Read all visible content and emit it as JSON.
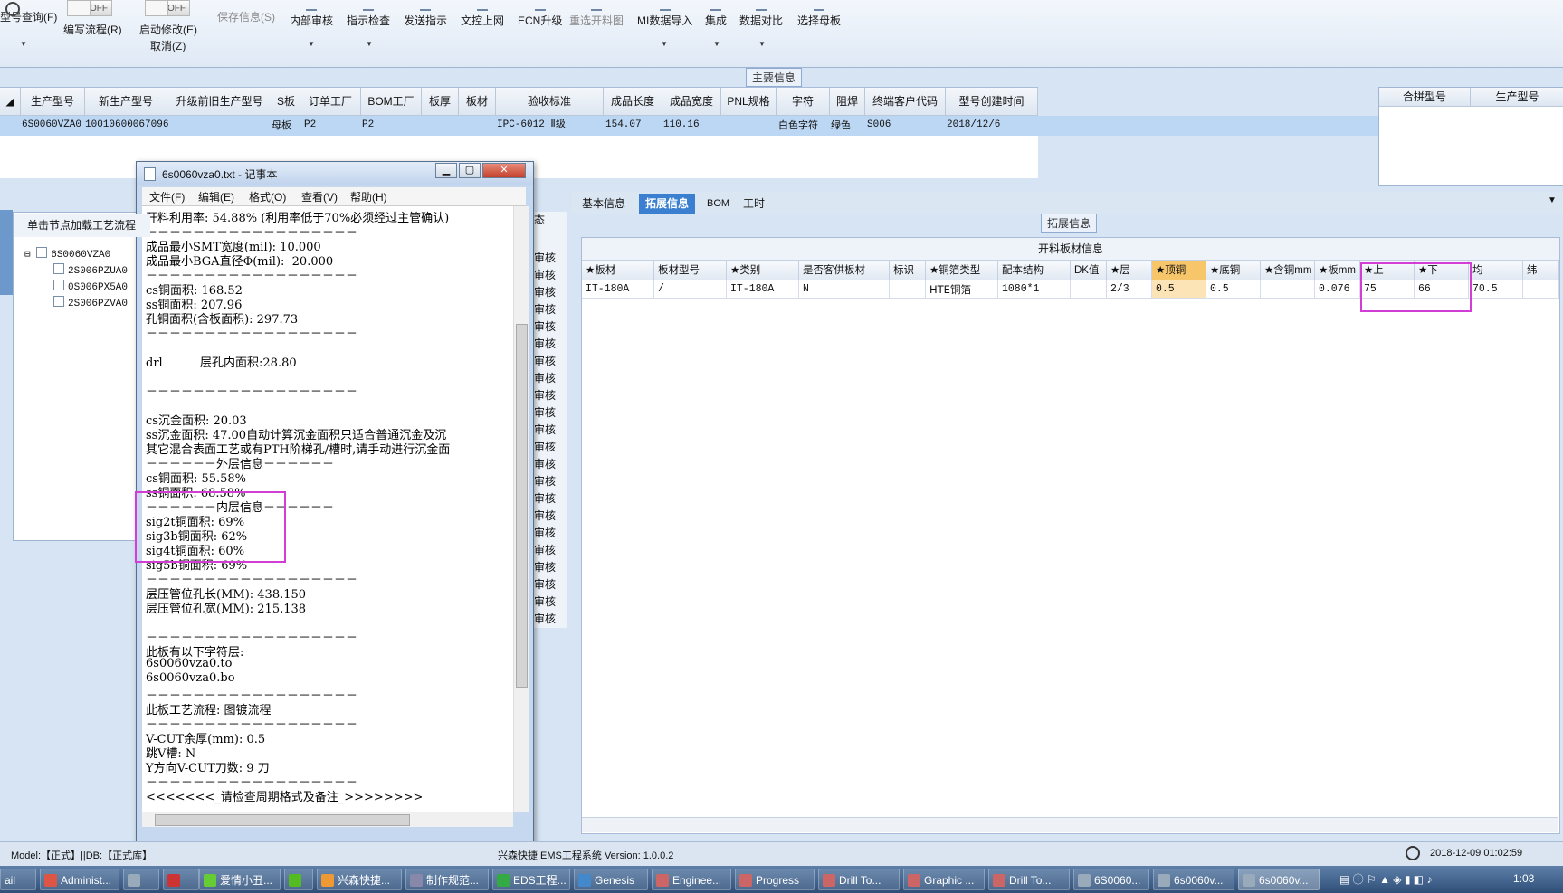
{
  "toolbar": {
    "items": [
      {
        "label": "型号查询(F)"
      },
      {
        "label": "编写流程(R)"
      },
      {
        "label": "启动修改(E)"
      },
      {
        "label": "取消(Z)"
      },
      {
        "label": "保存信息(S)"
      },
      {
        "label": "内部审核"
      },
      {
        "label": "指示检查"
      },
      {
        "label": "发送指示"
      },
      {
        "label": "文控上网"
      },
      {
        "label": "ECN升级"
      },
      {
        "label": "重选开料图"
      },
      {
        "label": "MI数据导入"
      },
      {
        "label": "集成"
      },
      {
        "label": "数据对比"
      },
      {
        "label": "选择母板"
      }
    ],
    "toggle1": "OFF",
    "toggle2": "OFF"
  },
  "main": {
    "section_title": "主要信息",
    "columns": [
      "生产型号",
      "新生产型号",
      "升级前旧生产型号",
      "S板",
      "订单工厂",
      "BOM工厂",
      "板厚",
      "板材",
      "验收标准",
      "成品长度",
      "成品宽度",
      "PNL规格",
      "字符",
      "阻焊",
      "终端客户代码",
      "型号创建时间"
    ],
    "row": {
      "c0": "6S0060VZA0",
      "c1": "10010600067096",
      "c2": "",
      "c3": "母板",
      "c4": "P2",
      "c5": "P2",
      "c6": "",
      "c7": "",
      "c8": "IPC-6012 Ⅱ级",
      "c9": "154.07",
      "c10": "110.16",
      "c11": "",
      "c12": "白色字符",
      "c13": "绿色",
      "c14": "S006",
      "c15": "2018/12/6"
    },
    "merge_columns": [
      "合拼型号",
      "生产型号"
    ]
  },
  "left": {
    "header": "单击节点加载工艺流程",
    "tree": [
      "6S0060VZA0",
      "2S006PZUA0",
      "0S006PX5A0",
      "2S006PZVA0"
    ],
    "status_header": "态",
    "status_items": [
      "审核",
      "审核",
      "审核",
      "审核",
      "审核",
      "审核",
      "审核",
      "审核",
      "审核",
      "审核",
      "审核",
      "审核",
      "审核",
      "审核",
      "审核",
      "审核",
      "审核",
      "审核",
      "审核",
      "审核",
      "审核",
      "审核"
    ]
  },
  "right": {
    "tabs": [
      "基本信息",
      "拓展信息",
      "BOM",
      "工时"
    ],
    "ext_title": "拓展信息",
    "grid_title": "开料板材信息",
    "columns": [
      "★板材",
      "板材型号",
      "★类别",
      "是否客供板材",
      "标识",
      "★铜箔类型",
      "配本结构",
      "DK值",
      "★层",
      "★顶铜",
      "★底铜",
      "★含铜mm",
      "★板mm",
      "★上",
      "★下",
      "均",
      "纬"
    ],
    "row": [
      "IT-180A",
      "/",
      "IT-180A",
      "N",
      "",
      "HTE铜箔",
      "1080*1",
      "",
      "2/3",
      "0.5",
      "0.5",
      "",
      "0.076",
      "75",
      "66",
      "70.5",
      ""
    ]
  },
  "notepad": {
    "title": "6s0060vza0.txt - 记事本",
    "menu": [
      "文件(F)",
      "编辑(E)",
      "格式(O)",
      "查看(V)",
      "帮助(H)"
    ],
    "lines": [
      "开料利用率: 54.88% (利用率低于70%必须经过主管确认)",
      "－－－－－－－－－－－－－－－－－－",
      "成品最小SMT宽度(mil): 10.000",
      "成品最小BGA直径Φ(mil):  20.000",
      "－－－－－－－－－－－－－－－－－－",
      "cs铜面积: 168.52",
      "ss铜面积: 207.96",
      "孔铜面积(含板面积): 297.73",
      "－－－－－－－－－－－－－－－－－－",
      "",
      "drl          层孔内面积:28.80",
      "",
      "－－－－－－－－－－－－－－－－－－",
      "",
      "cs沉金面积: 20.03",
      "ss沉金面积: 47.00自动计算沉金面积只适合普通沉金及沉",
      "其它混合表面工艺或有PTH阶梯孔/槽时,请手动进行沉金面",
      "－－－－－－外层信息－－－－－－",
      "cs铜面积: 55.58%",
      "ss铜面积: 68.58%",
      "－－－－－－内层信息－－－－－－",
      "sig2t铜面积: 69%",
      "sig3b铜面积: 62%",
      "sig4t铜面积: 60%",
      "sig5b铜面积: 69%",
      "－－－－－－－－－－－－－－－－－－",
      "层压管位孔长(MM): 438.150",
      "层压管位孔宽(MM): 215.138",
      "",
      "－－－－－－－－－－－－－－－－－－",
      "此板有以下字符层:",
      "6s0060vza0.to",
      "6s0060vza0.bo",
      "－－－－－－－－－－－－－－－－－－",
      "此板工艺流程: 图镀流程",
      "－－－－－－－－－－－－－－－－－－",
      "V-CUT余厚(mm): 0.5",
      "跳V槽: N",
      "Y方向V-CUT刀数: 9 刀",
      "－－－－－－－－－－－－－－－－－－",
      "<<<<<<<_请检查周期格式及备注_>>>>>>>>"
    ]
  },
  "statusbar": {
    "left": "Model:【正式】||DB:【正式库】",
    "center": "兴森快捷 EMS工程系统 Version: 1.0.0.2",
    "datetime": "2018-12-09 01:02:59"
  },
  "taskbar": {
    "items": [
      "ail",
      "Administ...",
      "",
      "",
      "爱情小丑...",
      "",
      "兴森快捷...",
      "制作规范...",
      "EDS工程...",
      "Genesis",
      "Enginee...",
      "Progress",
      "Drill To...",
      "Graphic ...",
      "Drill To...",
      "6S0060...",
      "6s0060v...",
      "6s0060v..."
    ],
    "clock": "1:03"
  },
  "colors": {
    "accent": "#3a7fd0",
    "highlight": "#f7c66b",
    "annotation": "#d23ed4"
  }
}
